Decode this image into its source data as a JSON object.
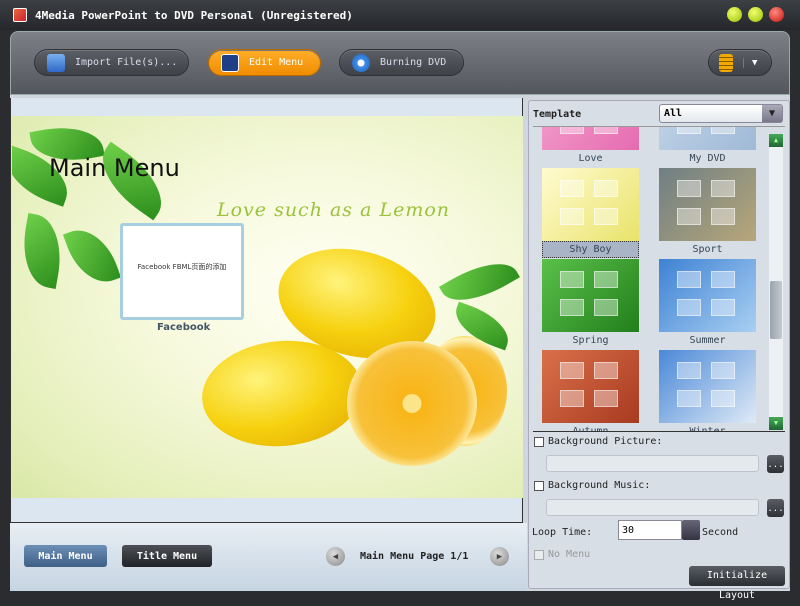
{
  "window": {
    "title": "4Media PowerPoint to DVD Personal (Unregistered)"
  },
  "toolbar": {
    "import_label": "Import File(s)...",
    "edit_menu_label": "Edit Menu",
    "burning_label": "Burning DVD"
  },
  "preview": {
    "menu_title": "Main Menu",
    "tagline": "Love such as a Lemon",
    "thumb_text": "Facebook FBML页面的添加",
    "thumb_caption": "Facebook"
  },
  "nav": {
    "main_menu": "Main Menu",
    "title_menu": "Title Menu",
    "page_label": "Main Menu Page 1/1"
  },
  "template": {
    "label": "Template",
    "filter": "All",
    "items": [
      {
        "name": "Love",
        "colors": [
          "#f5a7d0",
          "#e56bb0"
        ]
      },
      {
        "name": "My DVD",
        "colors": [
          "#c8d9ec",
          "#9fb9d6"
        ]
      },
      {
        "name": "Shy Boy",
        "colors": [
          "#fffbd0",
          "#e9e36a"
        ],
        "selected": true
      },
      {
        "name": "Sport",
        "colors": [
          "#6f7f83",
          "#b7a77a"
        ]
      },
      {
        "name": "Spring",
        "colors": [
          "#5ac04a",
          "#227f1c"
        ]
      },
      {
        "name": "Summer",
        "colors": [
          "#3e82d4",
          "#a9cff2"
        ]
      },
      {
        "name": "Autumn",
        "colors": [
          "#d9704a",
          "#a83a20"
        ]
      },
      {
        "name": "Winter",
        "colors": [
          "#4a88d8",
          "#dfeaf6"
        ]
      }
    ]
  },
  "options": {
    "bg_picture_label": "Background Picture:",
    "bg_music_label": "Background Music:",
    "browse": "...",
    "loop_label": "Loop Time:",
    "loop_value": "30",
    "loop_unit": "Second",
    "no_menu_label": "No Menu",
    "init_label": "Initialize Layout"
  }
}
